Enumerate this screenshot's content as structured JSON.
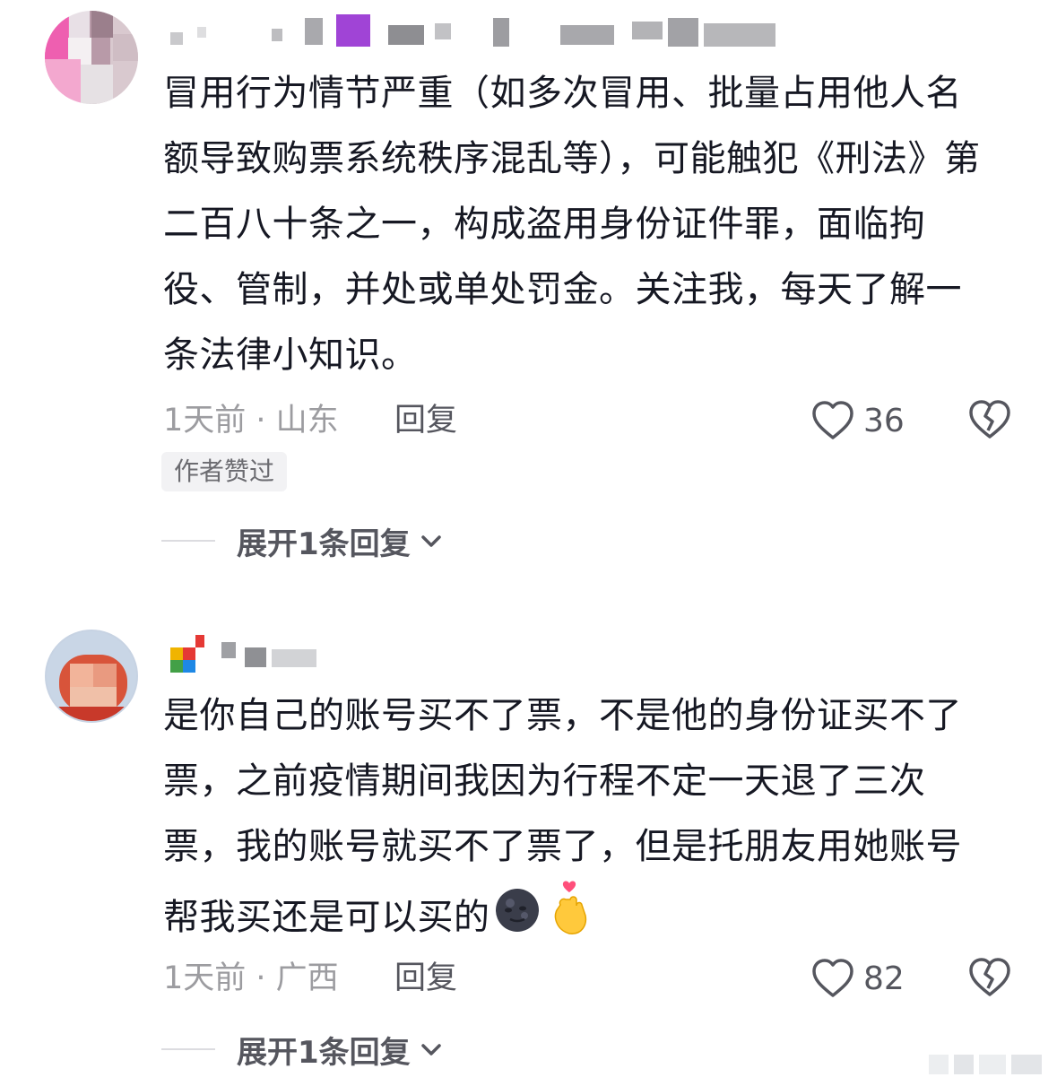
{
  "comments": [
    {
      "text": "冒用行为情节严重（如多次冒用、批量占用他人名额导致购票系统秩序混乱等），可能触犯《刑法》第二百八十条之一，构成盗用身份证件罪，面临拘役、管制，并处或单处罚金。关注我，每天了解一条法律小知识。",
      "time_location": "1天前 · 山东",
      "reply_label": "回复",
      "likes": "36",
      "badge": "作者赞过",
      "expand_label": "展开1条回复"
    },
    {
      "text": "是你自己的账号买不了票，不是他的身份证买不了票，之前疫情期间我因为行程不定一天退了三次票，我的账号就买不了票了，但是托朋友用她账号帮我买还是可以买的",
      "emojis": [
        "moon-face-icon",
        "finger-heart-icon"
      ],
      "time_location": "1天前 · 广西",
      "reply_label": "回复",
      "likes": "82",
      "expand_label": "展开1条回复"
    }
  ],
  "colors": {
    "text": "#161823",
    "meta": "#9c9ca0",
    "action": "#55565e",
    "badge_bg": "#f2f2f4"
  }
}
